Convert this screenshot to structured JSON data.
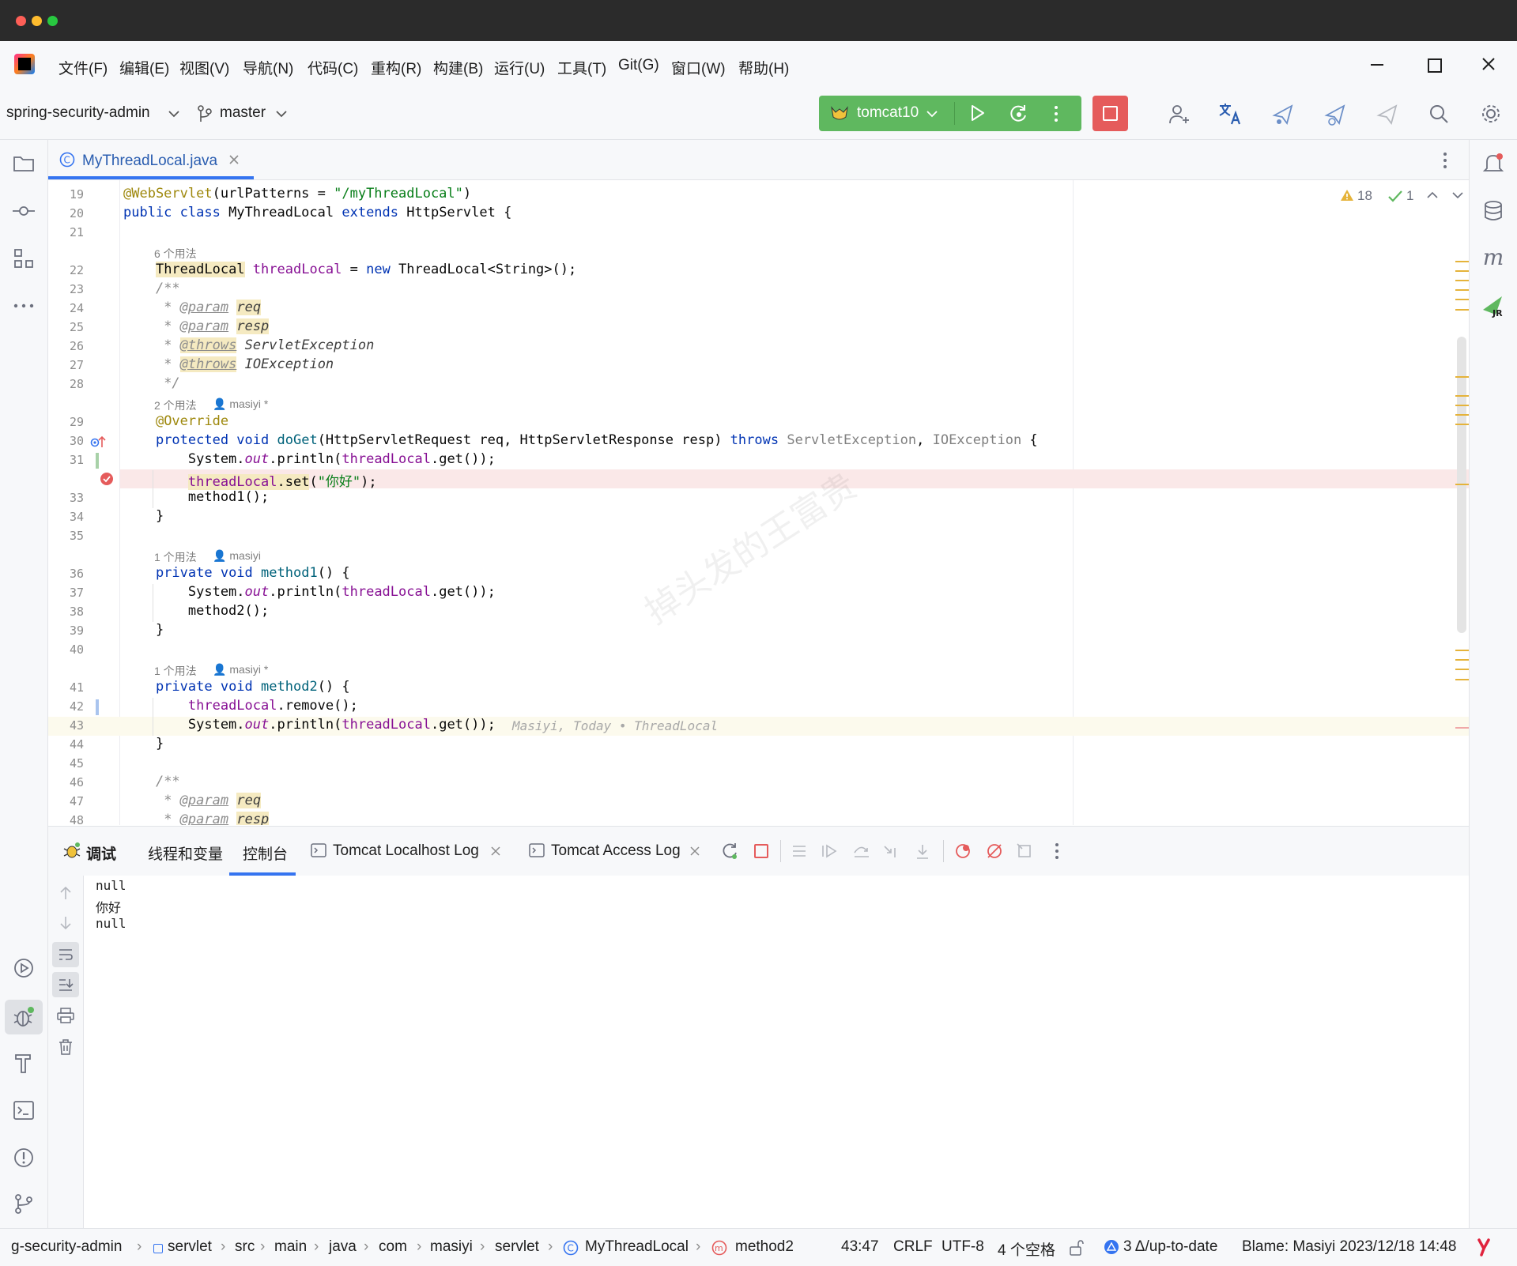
{
  "menu": [
    "文件(F)",
    "编辑(E)",
    "视图(V)",
    "导航(N)",
    "代码(C)",
    "重构(R)",
    "构建(B)",
    "运行(U)",
    "工具(T)",
    "Git(G)",
    "窗口(W)",
    "帮助(H)"
  ],
  "toolbar": {
    "project": "spring-security-admin",
    "branch": "master",
    "run_config": "tomcat10"
  },
  "editor_tab": {
    "label": "MyThreadLocal.java"
  },
  "inspection": {
    "warnings": "18",
    "checks": "1"
  },
  "code": {
    "l19": "19",
    "l20": "20",
    "l21": "21",
    "l22": "22",
    "l23": "23",
    "l24": "24",
    "l25": "25",
    "l26": "26",
    "l27": "27",
    "l28": "28",
    "l29": "29",
    "l30": "30",
    "l31": "31",
    "l33": "33",
    "l34": "34",
    "l35": "35",
    "l36": "36",
    "l37": "37",
    "l38": "38",
    "l39": "39",
    "l40": "40",
    "l41": "41",
    "l42": "42",
    "l43": "43",
    "l44": "44",
    "l45": "45",
    "l46": "46",
    "l47": "47",
    "l48": "48",
    "hint_usages_6": "6 个用法",
    "hint_usages_2": "2 个用法",
    "hint_usages_1a": "1 个用法",
    "hint_usages_1b": "1 个用法",
    "author_star": "masiyi *",
    "author": "masiyi",
    "author_star2": "masiyi *",
    "inline_blame": "Masiyi, Today • ThreadLocal",
    "watermark": "掉头发的王富贵"
  },
  "debug_tabs": {
    "debug": "调试",
    "threads": "线程和变量",
    "console": "控制台",
    "tomcat_localhost": "Tomcat Localhost Log",
    "tomcat_access": "Tomcat Access Log"
  },
  "console_output": [
    "null",
    "你好",
    "null"
  ],
  "status": {
    "breadcrumb": [
      "g-security-admin",
      "servlet",
      "src",
      "main",
      "java",
      "com",
      "masiyi",
      "servlet",
      "MyThreadLocal",
      "method2"
    ],
    "position": "43:47",
    "line_sep": "CRLF",
    "encoding": "UTF-8",
    "indent": "4 个空格",
    "vcs": "3 Δ/up-to-date",
    "blame": "Blame: Masiyi 2023/12/18 14:48"
  }
}
